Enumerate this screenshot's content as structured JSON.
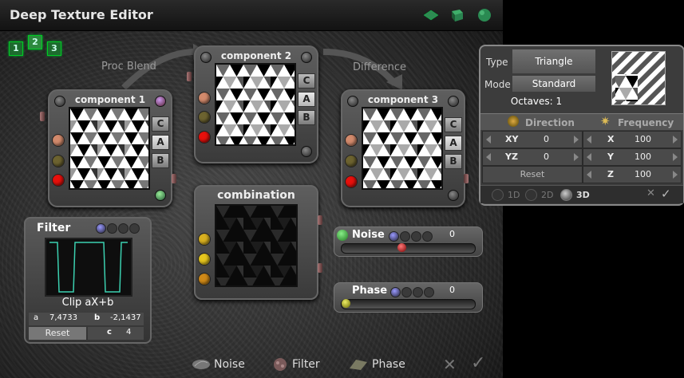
{
  "window": {
    "title": "Deep Texture Editor"
  },
  "tabs": [
    "1",
    "2",
    "3"
  ],
  "labels": {
    "proc_blend": "Proc Blend",
    "difference": "Difference"
  },
  "components": [
    {
      "title": "component 1",
      "buttons": [
        "C",
        "A",
        "B"
      ],
      "active": "A"
    },
    {
      "title": "component 2",
      "buttons": [
        "C",
        "A",
        "B"
      ],
      "active": "A"
    },
    {
      "title": "component 3",
      "buttons": [
        "C",
        "A",
        "B"
      ],
      "active": "A"
    }
  ],
  "combination": {
    "title": "combination"
  },
  "filter": {
    "title": "Filter",
    "mode": "Clip aX+b",
    "a_label": "a",
    "a_value": "7,4733",
    "b_label": "b",
    "b_value": "-2,1437",
    "c_label": "c",
    "c_value": "4",
    "reset": "Reset"
  },
  "noise": {
    "label": "Noise",
    "value": "0",
    "level": 0.45
  },
  "phase": {
    "label": "Phase",
    "value": "0",
    "level": 0.0
  },
  "bottom": {
    "noise": "Noise",
    "filter": "Filter",
    "phase": "Phase"
  },
  "right_panel": {
    "type_label": "Type",
    "type_value": "Triangle",
    "mode_label": "Mode",
    "mode_value": "Standard",
    "octaves": "Octaves: 1",
    "direction": "Direction",
    "frequency": "Frequency",
    "xy_label": "XY",
    "xy_value": "0",
    "yz_label": "YZ",
    "yz_value": "0",
    "reset": "Reset",
    "x_label": "X",
    "x_value": "100",
    "y_label": "Y",
    "y_value": "100",
    "z_label": "Z",
    "z_value": "100",
    "dims": [
      "1D",
      "2D",
      "3D"
    ],
    "selected_dim": "3D"
  },
  "colors": {
    "red": "#e8100c",
    "salmon": "#d28a6c",
    "olive": "#6d6330",
    "yellow1": "#d8b020",
    "yellow2": "#e6c61e",
    "yellow3": "#d08a18",
    "accent_green": "#1d6b2e"
  }
}
